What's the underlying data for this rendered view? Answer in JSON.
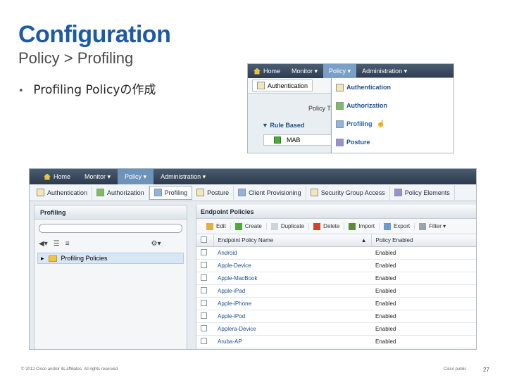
{
  "slide": {
    "title": "Configuration",
    "subtitle": "Policy > Profiling",
    "bullet": "Profiling Policyの作成",
    "footer_left": "© 2012 Cisco and/or its affiliates. All rights reserved.",
    "footer_right": "Cisco public",
    "page_number": "27"
  },
  "shot1": {
    "nav": [
      "Home",
      "Monitor ▾",
      "Policy ▾",
      "Administration ▾"
    ],
    "tab": "Authentication",
    "policy_label": "Policy T",
    "rule_based": "▼ Rule Based",
    "row_value": "MAB",
    "dropdown": [
      "Authentication",
      "Authorization",
      "Profiling",
      "Posture"
    ]
  },
  "shot2": {
    "nav": [
      "Home",
      "Monitor ▾",
      "Policy ▾",
      "Administration ▾"
    ],
    "tabs": [
      "Authentication",
      "Authorization",
      "Profiling",
      "Posture",
      "Client Provisioning",
      "Security Group Access",
      "Policy Elements"
    ],
    "left_header": "Profiling",
    "tree_item": "Profiling Policies",
    "right_header": "Endpoint Policies",
    "toolbar": [
      "Edit",
      "Create",
      "Duplicate",
      "Delete",
      "Import",
      "Export",
      "Filter ▾"
    ],
    "columns": [
      "Endpoint Policy Name",
      "Policy Enabled"
    ],
    "rows": [
      {
        "name": "Android",
        "enabled": "Enabled"
      },
      {
        "name": "Apple-Device",
        "enabled": "Enabled"
      },
      {
        "name": "Apple-MacBook",
        "enabled": "Enabled"
      },
      {
        "name": "Apple-iPad",
        "enabled": "Enabled"
      },
      {
        "name": "Apple-iPhone",
        "enabled": "Enabled"
      },
      {
        "name": "Apple-iPod",
        "enabled": "Enabled"
      },
      {
        "name": "Applera-Device",
        "enabled": "Enabled"
      },
      {
        "name": "Aruba-AP",
        "enabled": "Enabled"
      }
    ]
  },
  "colors": {
    "title": "#1d5aa6",
    "nav_bg": "#2e3d50",
    "link": "#1d4f8c"
  }
}
